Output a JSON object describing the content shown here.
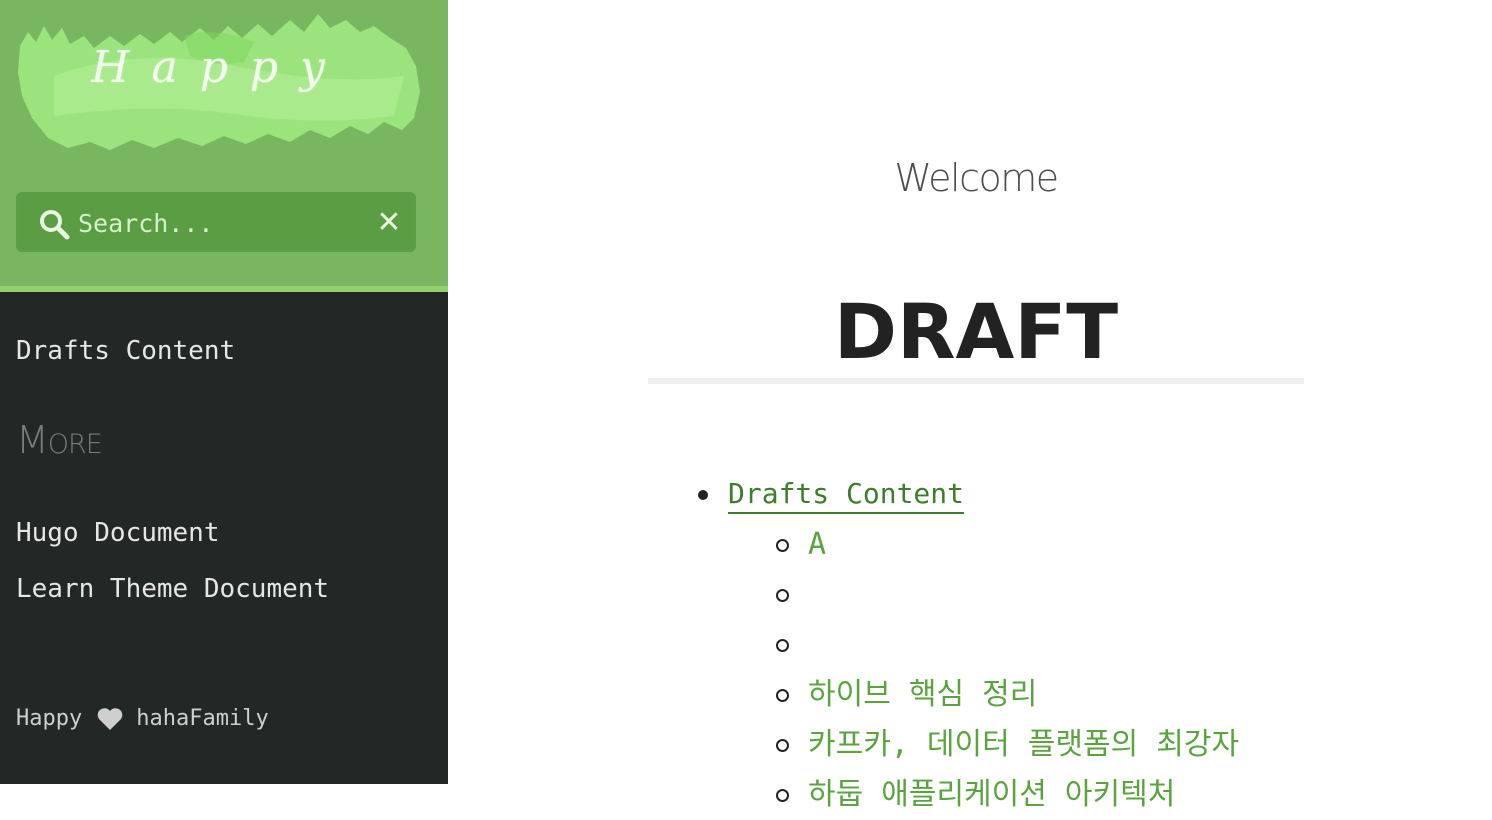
{
  "sidebar": {
    "logo_text": "Happy",
    "search": {
      "placeholder": "Search..."
    },
    "menu": {
      "drafts_label": "Drafts Content"
    },
    "more": {
      "heading": "More",
      "links": [
        "Hugo Document",
        "Learn Theme Document"
      ]
    },
    "footer": {
      "left": "Happy",
      "right": "hahaFamily"
    }
  },
  "main": {
    "welcome": "Welcome",
    "title": "DRAFT",
    "toc": {
      "top_label": "Drafts Content",
      "items": [
        "A",
        "",
        "",
        "하이브 핵심 정리",
        "카프카, 데이터 플랫폼의 최강자",
        "하둡 애플리케이션 아키텍처"
      ]
    }
  },
  "colors": {
    "header_green": "#78b760",
    "sidebar_dark": "#222826",
    "link_green": "#5aa33e",
    "link_dark_green": "#3f7d2c"
  },
  "icons": [
    "search-icon",
    "close-icon",
    "heart-icon"
  ]
}
